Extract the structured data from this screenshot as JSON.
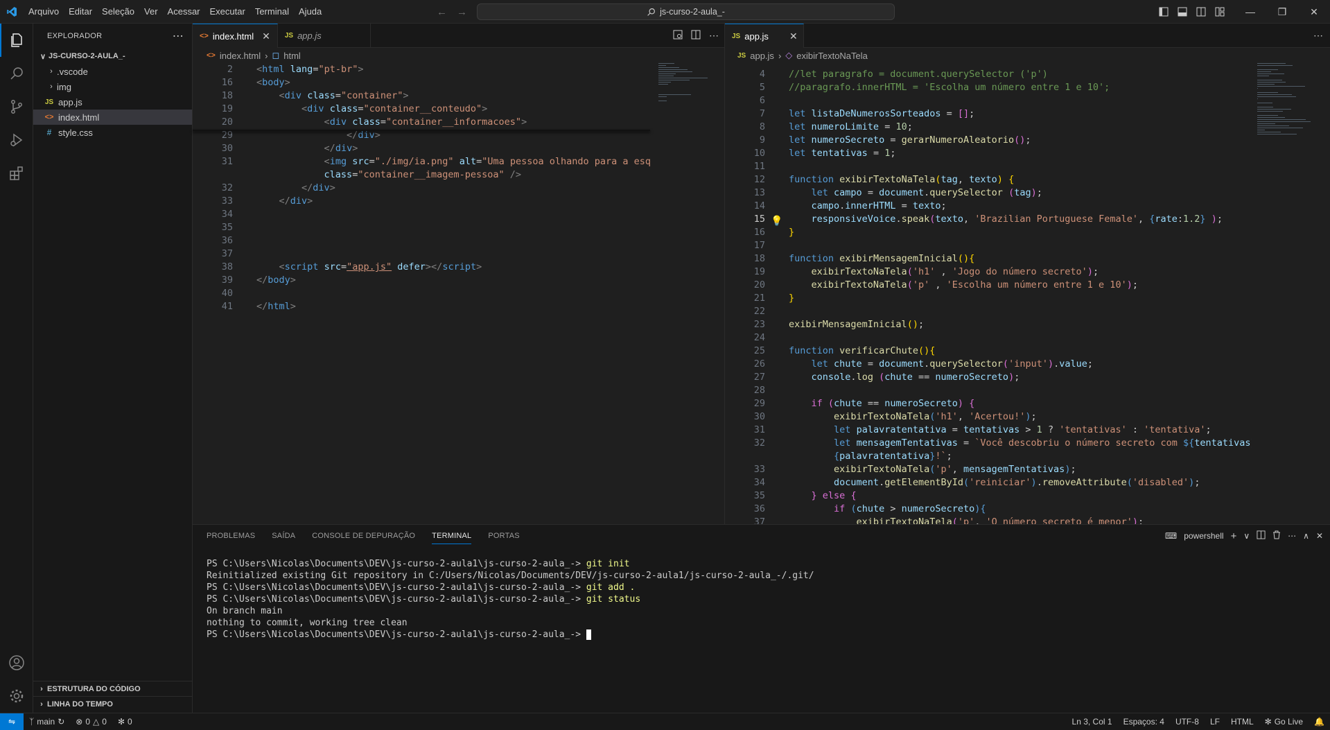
{
  "titlebar": {
    "menu": [
      "Arquivo",
      "Editar",
      "Seleção",
      "Ver",
      "Acessar",
      "Executar",
      "Terminal",
      "Ajuda"
    ],
    "search": "js-curso-2-aula_-"
  },
  "sidebar": {
    "header": "EXPLORADOR",
    "root": "JS-CURSO-2-AULA_-",
    "items": [
      {
        "label": ".vscode",
        "icon": "chevron-right-icon",
        "type": "folder"
      },
      {
        "label": "img",
        "icon": "chevron-right-icon",
        "type": "folder"
      },
      {
        "label": "app.js",
        "icon": "js-file-icon",
        "type": "file"
      },
      {
        "label": "index.html",
        "icon": "html-file-icon",
        "type": "file"
      },
      {
        "label": "style.css",
        "icon": "css-file-icon",
        "type": "file"
      }
    ],
    "outline": "ESTRUTURA DO CÓDIGO",
    "timeline": "LINHA DO TEMPO"
  },
  "left_editor": {
    "tabs": [
      {
        "label": "index.html",
        "active": true
      },
      {
        "label": "app.js",
        "active": false
      }
    ],
    "breadcrumb": [
      "index.html",
      "html"
    ],
    "lines": [
      {
        "n": "2",
        "html": "<span class='p'>&lt;</span><span class='tg'>html</span> <span class='at'>lang</span>=<span class='s'>\"pt-br\"</span><span class='p'>&gt;</span>"
      },
      {
        "n": "16",
        "html": "<span class='p'>&lt;</span><span class='tg'>body</span><span class='p'>&gt;</span>"
      },
      {
        "n": "18",
        "html": "    <span class='p'>&lt;</span><span class='tg'>div</span> <span class='at'>class</span>=<span class='s'>\"container\"</span><span class='p'>&gt;</span>"
      },
      {
        "n": "19",
        "html": "        <span class='p'>&lt;</span><span class='tg'>div</span> <span class='at'>class</span>=<span class='s'>\"container__conteudo\"</span><span class='p'>&gt;</span>"
      },
      {
        "n": "20",
        "html": "            <span class='p'>&lt;</span><span class='tg'>div</span> <span class='at'>class</span>=<span class='s'>\"container__informacoes\"</span><span class='p'>&gt;</span>"
      },
      {
        "n": "29",
        "html": "                <span class='p'>&lt;/</span><span class='tg'>div</span><span class='p'>&gt;</span>"
      },
      {
        "n": "30",
        "html": "            <span class='p'>&lt;/</span><span class='tg'>div</span><span class='p'>&gt;</span>"
      },
      {
        "n": "31",
        "html": "            <span class='p'>&lt;</span><span class='tg'>img</span> <span class='at'>src</span>=<span class='s'>\"./img/ia.png\"</span> <span class='at'>alt</span>=<span class='s'>\"Uma pessoa olhando para a esquerda\"</span>"
      },
      {
        "n": "",
        "html": "            <span class='at'>class</span>=<span class='s'>\"container__imagem-pessoa\"</span> <span class='p'>/&gt;</span>"
      },
      {
        "n": "32",
        "html": "        <span class='p'>&lt;/</span><span class='tg'>div</span><span class='p'>&gt;</span>"
      },
      {
        "n": "33",
        "html": "    <span class='p'>&lt;/</span><span class='tg'>div</span><span class='p'>&gt;</span>"
      },
      {
        "n": "34",
        "html": ""
      },
      {
        "n": "35",
        "html": ""
      },
      {
        "n": "36",
        "html": ""
      },
      {
        "n": "37",
        "html": ""
      },
      {
        "n": "38",
        "html": "    <span class='p'>&lt;</span><span class='tg'>script</span> <span class='at'>src</span>=<span class='s' style='text-decoration:underline'>\"app.js\"</span> <span class='at'>defer</span><span class='p'>&gt;&lt;/</span><span class='tg'>script</span><span class='p'>&gt;</span>"
      },
      {
        "n": "39",
        "html": "<span class='p'>&lt;/</span><span class='tg'>body</span><span class='p'>&gt;</span>"
      },
      {
        "n": "40",
        "html": ""
      },
      {
        "n": "41",
        "html": "<span class='p'>&lt;/</span><span class='tg'>html</span><span class='p'>&gt;</span>"
      }
    ]
  },
  "right_editor": {
    "tabs": [
      {
        "label": "app.js",
        "active": true
      }
    ],
    "breadcrumb": [
      "app.js",
      "exibirTextoNaTela"
    ],
    "lines": [
      {
        "n": "4",
        "html": "<span class='c'>//let paragrafo = document.querySelector ('p')</span>"
      },
      {
        "n": "5",
        "html": "<span class='c'>//paragrafo.innerHTML = 'Escolha um número entre 1 e 10';</span>"
      },
      {
        "n": "6",
        "html": ""
      },
      {
        "n": "7",
        "html": "<span class='k'>let</span> <span class='v'>listaDeNumerosSorteados</span> = <span class='pu'>[]</span>;"
      },
      {
        "n": "8",
        "html": "<span class='k'>let</span> <span class='v'>numeroLimite</span> = <span class='nu'>10</span>;"
      },
      {
        "n": "9",
        "html": "<span class='k'>let</span> <span class='v'>numeroSecreto</span> = <span class='f'>gerarNumeroAleatorio</span><span class='pu'>()</span>;"
      },
      {
        "n": "10",
        "html": "<span class='k'>let</span> <span class='v'>tentativas</span> = <span class='nu'>1</span>;"
      },
      {
        "n": "11",
        "html": ""
      },
      {
        "n": "12",
        "html": "<span class='k'>function</span> <span class='f'>exibirTextoNaTela</span><span class='y'>(</span><span class='v'>tag</span>, <span class='v'>texto</span><span class='y'>)</span> <span class='y'>{</span>"
      },
      {
        "n": "13",
        "html": "    <span class='k'>let</span> <span class='v'>campo</span> = <span class='v'>document</span>.<span class='f'>querySelector</span> <span class='pu'>(</span><span class='v'>tag</span><span class='pu'>)</span>;"
      },
      {
        "n": "14",
        "html": "    <span class='v'>campo</span>.<span class='v'>innerHTML</span> = <span class='v'>texto</span>;"
      },
      {
        "n": "15",
        "html": "    <span class='v'>responsiveVoice</span>.<span class='f'>speak</span><span class='pu'>(</span><span class='v'>texto</span>, <span class='s'>'Brazilian Portuguese Female'</span>, <span class='k'>{</span><span class='v'>rate</span>:<span class='nu'>1.2</span><span class='k'>}</span> <span class='pu'>)</span>;"
      },
      {
        "n": "16",
        "html": "<span class='y'>}</span>"
      },
      {
        "n": "17",
        "html": ""
      },
      {
        "n": "18",
        "html": "<span class='k'>function</span> <span class='f'>exibirMensagemInicial</span><span class='y'>()</span><span class='y'>{</span>"
      },
      {
        "n": "19",
        "html": "    <span class='f'>exibirTextoNaTela</span><span class='pu'>(</span><span class='s'>'h1'</span> , <span class='s'>'Jogo do número secreto'</span><span class='pu'>)</span>;"
      },
      {
        "n": "20",
        "html": "    <span class='f'>exibirTextoNaTela</span><span class='pu'>(</span><span class='s'>'p'</span> , <span class='s'>'Escolha um número entre 1 e 10'</span><span class='pu'>)</span>;"
      },
      {
        "n": "21",
        "html": "<span class='y'>}</span>"
      },
      {
        "n": "22",
        "html": ""
      },
      {
        "n": "23",
        "html": "<span class='f'>exibirMensagemInicial</span><span class='y'>()</span>;"
      },
      {
        "n": "24",
        "html": ""
      },
      {
        "n": "25",
        "html": "<span class='k'>function</span> <span class='f'>verificarChute</span><span class='y'>()</span><span class='y'>{</span>"
      },
      {
        "n": "26",
        "html": "    <span class='k'>let</span> <span class='v'>chute</span> = <span class='v'>document</span>.<span class='f'>querySelector</span><span class='pu'>(</span><span class='s'>'input'</span><span class='pu'>)</span>.<span class='v'>value</span>;"
      },
      {
        "n": "27",
        "html": "    <span class='v'>console</span>.<span class='f'>log</span> <span class='pu'>(</span><span class='v'>chute</span> == <span class='v'>numeroSecreto</span><span class='pu'>)</span>;"
      },
      {
        "n": "28",
        "html": ""
      },
      {
        "n": "29",
        "html": "    <span class='pu'>if</span> <span class='pu'>(</span><span class='v'>chute</span> == <span class='v'>numeroSecreto</span><span class='pu'>)</span> <span class='pu'>{</span>"
      },
      {
        "n": "30",
        "html": "        <span class='f'>exibirTextoNaTela</span><span class='k'>(</span><span class='s'>'h1'</span>, <span class='s'>'Acertou!'</span><span class='k'>)</span>;"
      },
      {
        "n": "31",
        "html": "        <span class='k'>let</span> <span class='v'>palavratentativa</span> = <span class='v'>tentativas</span> &gt; <span class='nu'>1</span> ? <span class='s'>'tentativas'</span> : <span class='s'>'tentativa'</span>;"
      },
      {
        "n": "32",
        "html": "        <span class='k'>let</span> <span class='v'>mensagemTentativas</span> = <span class='s'>`Você descobriu o número secreto com </span><span class='k'>${</span><span class='v'>tentativas</span><span class='k'>}</span> <span class='k'>$</span>"
      },
      {
        "n": "",
        "html": "        <span class='k'>{</span><span class='v'>palavratentativa</span><span class='k'>}</span><span class='s'>!`</span>;"
      },
      {
        "n": "33",
        "html": "        <span class='f'>exibirTextoNaTela</span><span class='k'>(</span><span class='s'>'p'</span>, <span class='v'>mensagemTentativas</span><span class='k'>)</span>;"
      },
      {
        "n": "34",
        "html": "        <span class='v'>document</span>.<span class='f'>getElementById</span><span class='k'>(</span><span class='s'>'reiniciar'</span><span class='k'>)</span>.<span class='f'>removeAttribute</span><span class='k'>(</span><span class='s'>'disabled'</span><span class='k'>)</span>;"
      },
      {
        "n": "35",
        "html": "    <span class='pu'>}</span> <span class='pu'>else</span> <span class='pu'>{</span>"
      },
      {
        "n": "36",
        "html": "        <span class='pu'>if</span> <span class='k'>(</span><span class='v'>chute</span> &gt; <span class='v'>numeroSecreto</span><span class='k'>)</span><span class='k'>{</span>"
      },
      {
        "n": "37",
        "html": "            <span class='f'>exibirTextoNaTela</span><span class='pu'>(</span><span class='s'>'p'</span>, <span class='s'>'O número secreto é menor'</span><span class='pu'>)</span>;"
      }
    ]
  },
  "panel": {
    "tabs": [
      "PROBLEMAS",
      "SAÍDA",
      "CONSOLE DE DEPURAÇÃO",
      "TERMINAL",
      "PORTAS"
    ],
    "active_tab": "TERMINAL",
    "shell": "powershell",
    "terminal": [
      {
        "prompt": "PS C:\\Users\\Nicolas\\Documents\\DEV\\js-curso-2-aula1\\js-curso-2-aula_-> ",
        "cmd": "git init"
      },
      {
        "prompt": "Reinitialized existing Git repository in C:/Users/Nicolas/Documents/DEV/js-curso-2-aula1/js-curso-2-aula_-/.git/",
        "cmd": ""
      },
      {
        "prompt": "PS C:\\Users\\Nicolas\\Documents\\DEV\\js-curso-2-aula1\\js-curso-2-aula_-> ",
        "cmd": "git add ."
      },
      {
        "prompt": "PS C:\\Users\\Nicolas\\Documents\\DEV\\js-curso-2-aula1\\js-curso-2-aula_-> ",
        "cmd": "git status"
      },
      {
        "prompt": "On branch main",
        "cmd": ""
      },
      {
        "prompt": "nothing to commit, working tree clean",
        "cmd": ""
      },
      {
        "prompt": "PS C:\\Users\\Nicolas\\Documents\\DEV\\js-curso-2-aula1\\js-curso-2-aula_-> ",
        "cmd": ""
      }
    ]
  },
  "statusbar": {
    "branch": "main",
    "errors": "0",
    "warnings": "0",
    "ports": "0",
    "position": "Ln 3, Col 1",
    "spaces": "Espaços: 4",
    "encoding": "UTF-8",
    "eol": "LF",
    "language": "HTML",
    "golive": "Go Live"
  },
  "colors": {
    "accent": "#0078d4",
    "bg": "#1f1f1f",
    "sidebar": "#181818"
  }
}
